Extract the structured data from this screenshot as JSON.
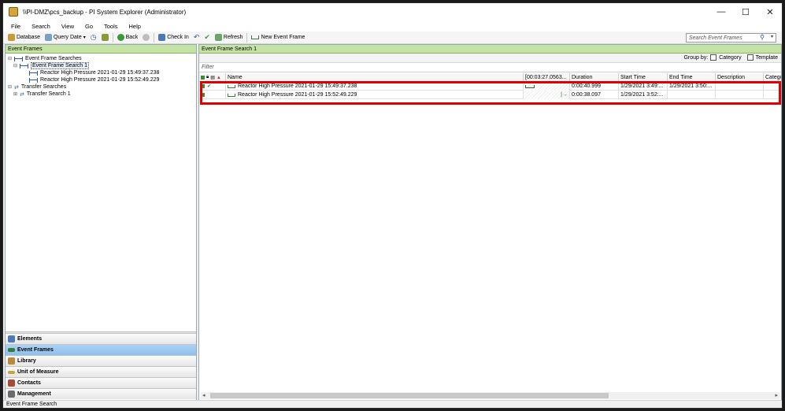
{
  "window": {
    "title": "\\\\PI-DMZ\\pcs_backup - PI System Explorer (Administrator)",
    "minimize_glyph": "—",
    "maximize_glyph": "☐",
    "close_glyph": "✕"
  },
  "menu": [
    "File",
    "Search",
    "View",
    "Go",
    "Tools",
    "Help"
  ],
  "toolbar": {
    "database": "Database",
    "query_date": "Query Date",
    "back": "Back",
    "check_in": "Check In",
    "refresh": "Refresh",
    "new_event_frame": "New Event Frame",
    "search_placeholder": "Search Event Frames"
  },
  "left_pane": {
    "header": "Event Frames",
    "tree": [
      {
        "label": "Event Frame Searches"
      },
      {
        "label": "Event Frame Search 1"
      },
      {
        "label": "Reactor High Pressure 2021-01-29 15:49:37.238"
      },
      {
        "label": "Reactor High Pressure 2021-01-29 15:52:49.229"
      },
      {
        "label": "Transfer Searches"
      },
      {
        "label": "Transfer Search 1"
      }
    ],
    "nav": [
      "Elements",
      "Event Frames",
      "Library",
      "Unit of Measure",
      "Contacts",
      "Management"
    ]
  },
  "right_pane": {
    "header": "Event Frame Search 1",
    "group_by": "Group by:",
    "category": "Category",
    "template": "Template",
    "filter_placeholder": "Filter",
    "columns": {
      "name": "Name",
      "timeline": "[00:03:27.0563...",
      "duration": "Duration",
      "start": "Start Time",
      "end": "End Time",
      "description": "Description",
      "category": "Catego"
    },
    "rows": [
      {
        "name": "Reactor High Pressure 2021-01-29 15:49:37.238",
        "duration": "0:00:40.999",
        "start": "1/29/2021 3:49:...",
        "end": "1/29/2021 3:50:..."
      },
      {
        "name": "Reactor High Pressure 2021-01-29 15:52:49.229",
        "duration": "0:00:38.097",
        "start": "1/29/2021 3:52:...",
        "end": ""
      }
    ]
  },
  "status": "Event Frame Search",
  "colors": {
    "pane_header": "#c6e3a6",
    "nav_active": "#8ec1ec",
    "highlight": "#e00000"
  }
}
